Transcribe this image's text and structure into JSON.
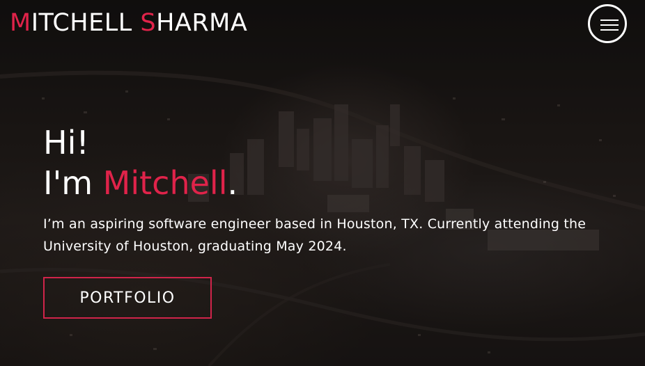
{
  "header": {
    "logo_first_initial": "M",
    "logo_first_rest": "ITCHELL ",
    "logo_last_initial": "S",
    "logo_last_rest": "HARMA",
    "menu_icon": "hamburger-icon"
  },
  "hero": {
    "greeting_line1": "Hi!",
    "greeting_prefix": "I'm ",
    "greeting_name": "Mitchell",
    "greeting_suffix": ".",
    "intro": "I’m an aspiring software engineer based in Houston, TX. Currently attending the University of Houston, graduating May 2024.",
    "cta_label": "PORTFOLIO"
  },
  "colors": {
    "accent": "#e0234a",
    "text": "#ffffff",
    "background": "#1a1512"
  }
}
